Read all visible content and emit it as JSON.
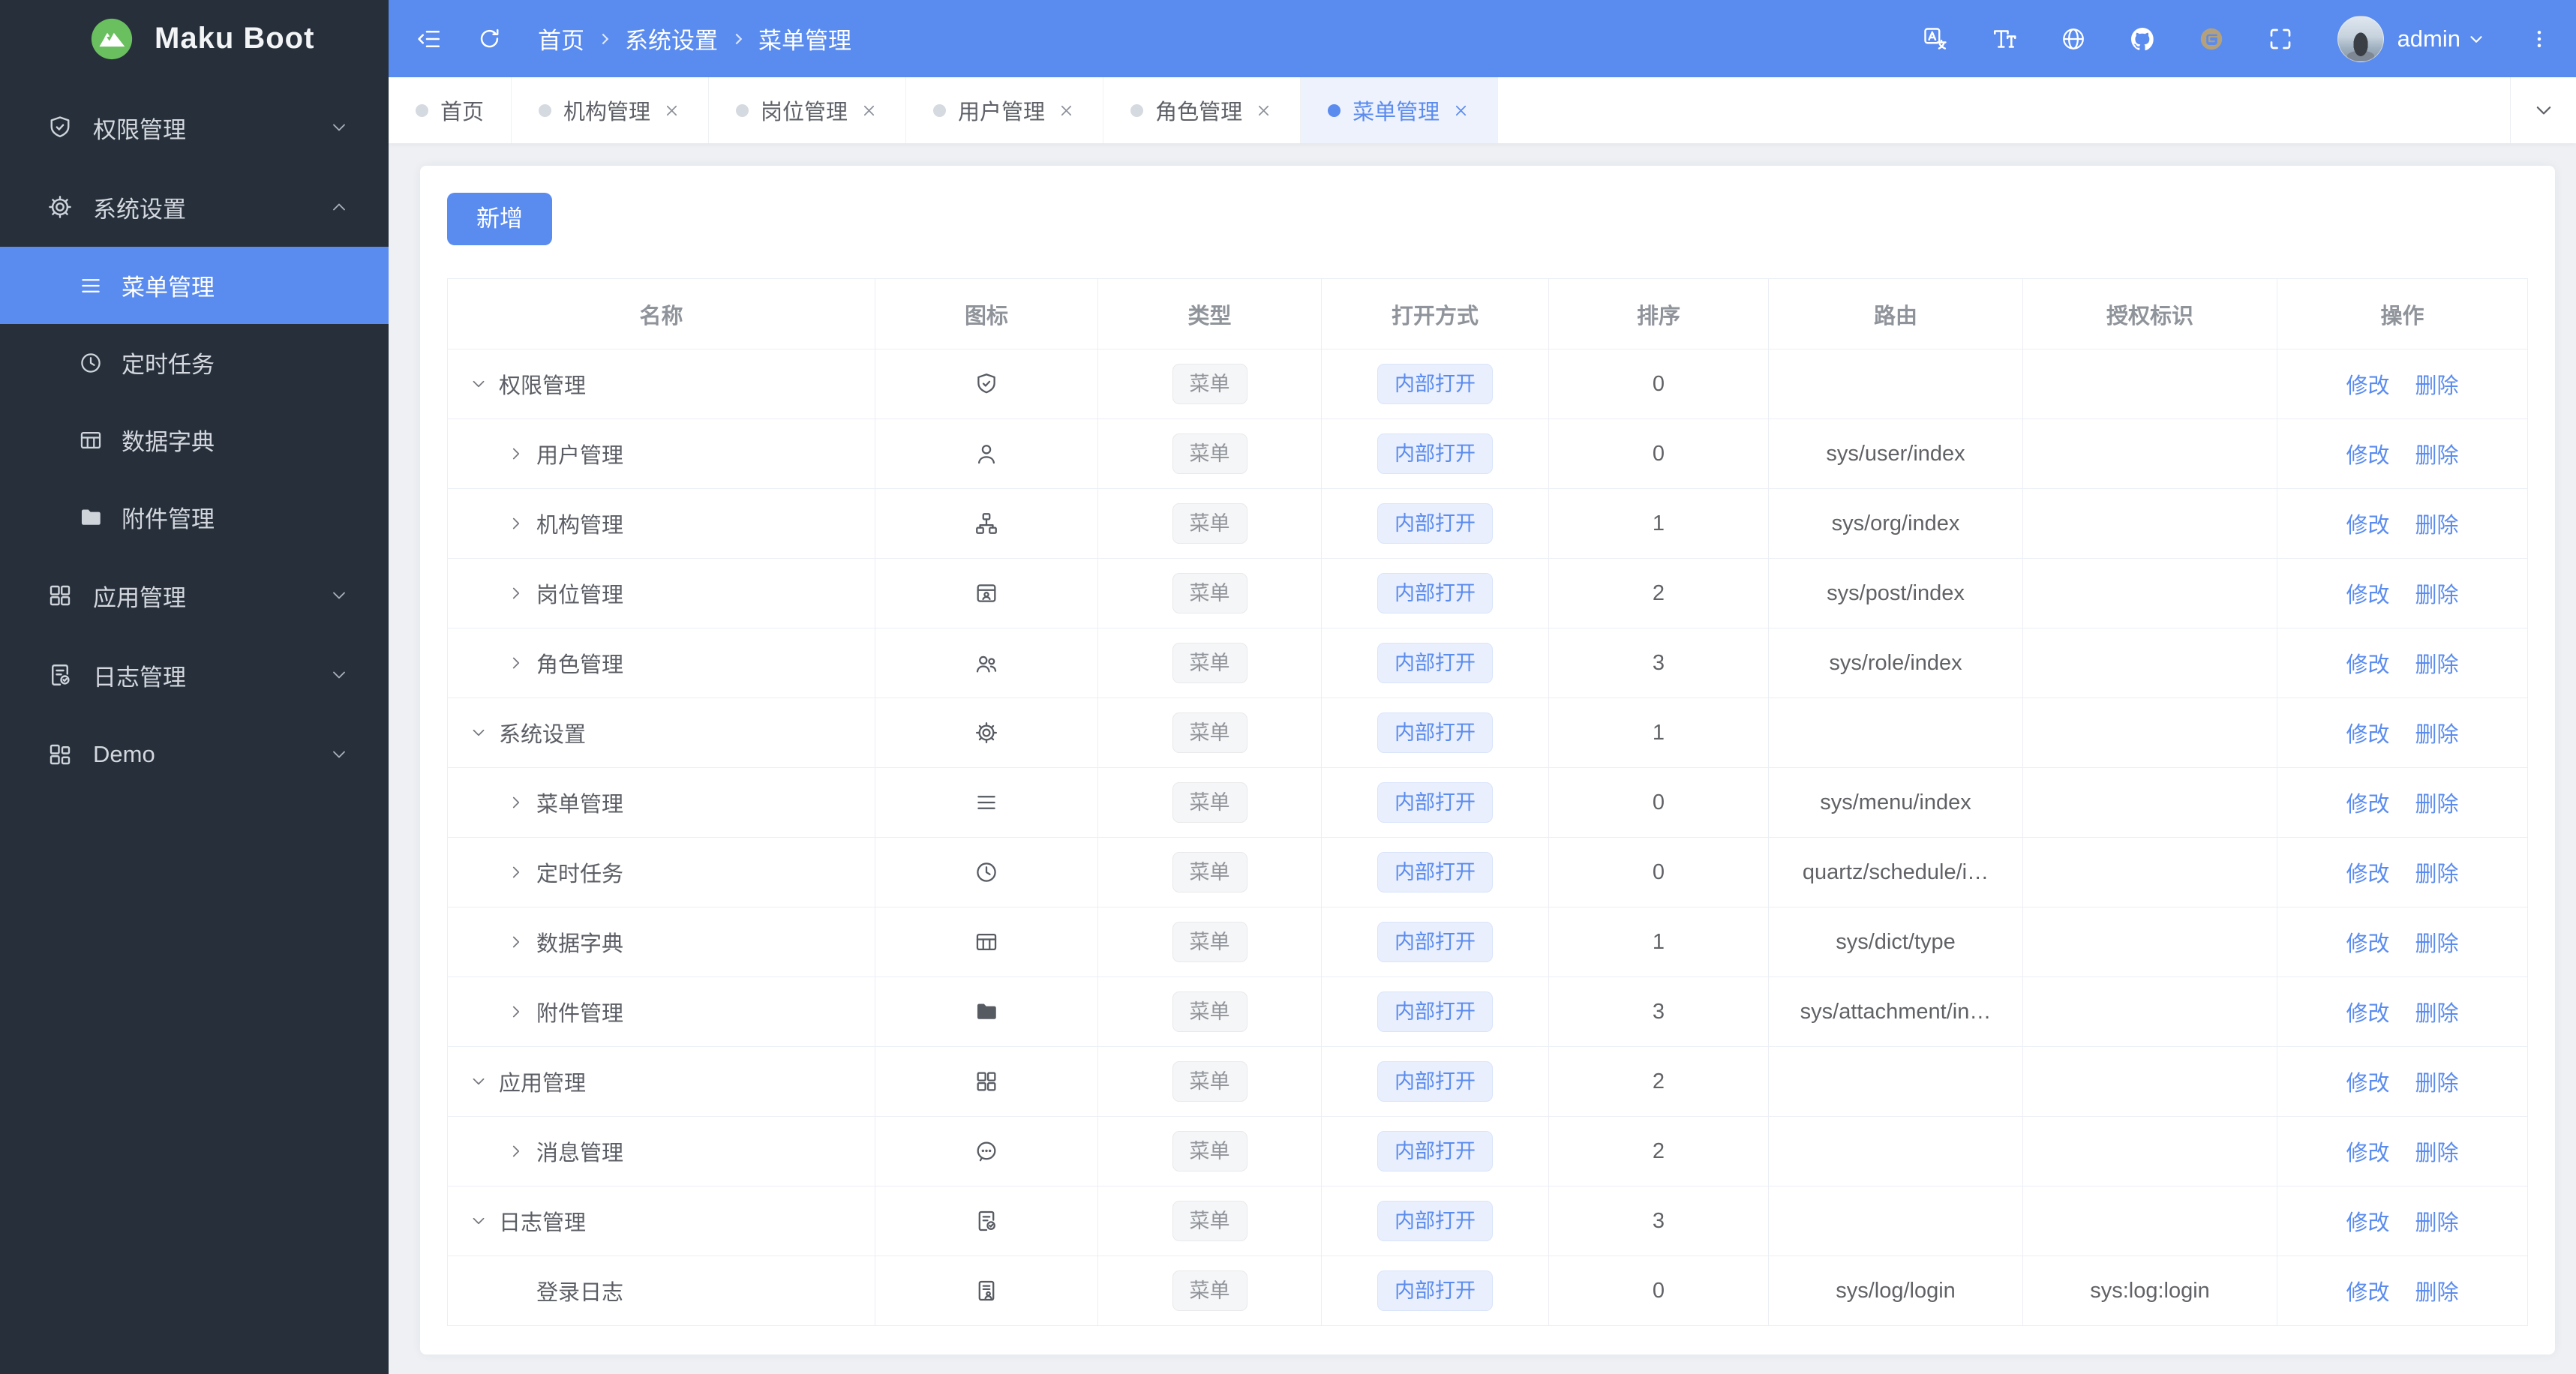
{
  "app": {
    "name": "Maku Boot"
  },
  "colors": {
    "accent": "#5a8bee",
    "sidebar_bg": "#262f3a",
    "header_bg": "#5a8bee",
    "content_bg": "#eef0f4",
    "tag_blue_bg": "#e9effd",
    "tag_gray_text": "#909399",
    "logo_green": "#6abf5e"
  },
  "header": {
    "breadcrumb": [
      "首页",
      "系统设置",
      "菜单管理"
    ],
    "user": "admin",
    "right_icons": [
      "translate-icon",
      "font-size-icon",
      "globe-icon",
      "github-icon",
      "gitee-icon",
      "fullscreen-icon"
    ]
  },
  "tabs": [
    {
      "label": "首页",
      "closable": false,
      "active": false
    },
    {
      "label": "机构管理",
      "closable": true,
      "active": false
    },
    {
      "label": "岗位管理",
      "closable": true,
      "active": false
    },
    {
      "label": "用户管理",
      "closable": true,
      "active": false
    },
    {
      "label": "角色管理",
      "closable": true,
      "active": false
    },
    {
      "label": "菜单管理",
      "closable": true,
      "active": true
    }
  ],
  "sidebar": {
    "items": [
      {
        "label": "权限管理",
        "icon": "shield-icon",
        "chevron": "chevron-down-icon"
      },
      {
        "label": "系统设置",
        "icon": "gear-icon",
        "chevron": "chevron-up-icon",
        "expanded": true,
        "children": [
          {
            "label": "菜单管理",
            "icon": "menu-icon",
            "active": true
          },
          {
            "label": "定时任务",
            "icon": "clock-icon",
            "active": false
          },
          {
            "label": "数据字典",
            "icon": "dict-icon",
            "active": false
          },
          {
            "label": "附件管理",
            "icon": "folder-icon",
            "active": false
          }
        ]
      },
      {
        "label": "应用管理",
        "icon": "apps-icon",
        "chevron": "chevron-down-icon"
      },
      {
        "label": "日志管理",
        "icon": "log-icon",
        "chevron": "chevron-down-icon"
      },
      {
        "label": "Demo",
        "icon": "demo-icon",
        "chevron": "chevron-down-icon"
      }
    ]
  },
  "toolbar": {
    "add_label": "新增"
  },
  "table": {
    "columns": [
      "名称",
      "图标",
      "类型",
      "打开方式",
      "排序",
      "路由",
      "授权标识",
      "操作"
    ],
    "ops": [
      "修改",
      "删除"
    ],
    "rows": [
      {
        "level": 1,
        "arrow": "expanded",
        "name": "权限管理",
        "icon": "shield-icon",
        "type": "菜单",
        "open": "内部打开",
        "sort": "0",
        "route": "",
        "auth": ""
      },
      {
        "level": 2,
        "arrow": "collapsed",
        "name": "用户管理",
        "icon": "user-icon",
        "type": "菜单",
        "open": "内部打开",
        "sort": "0",
        "route": "sys/user/index",
        "auth": ""
      },
      {
        "level": 2,
        "arrow": "collapsed",
        "name": "机构管理",
        "icon": "org-icon",
        "type": "菜单",
        "open": "内部打开",
        "sort": "1",
        "route": "sys/org/index",
        "auth": ""
      },
      {
        "level": 2,
        "arrow": "collapsed",
        "name": "岗位管理",
        "icon": "post-icon",
        "type": "菜单",
        "open": "内部打开",
        "sort": "2",
        "route": "sys/post/index",
        "auth": ""
      },
      {
        "level": 2,
        "arrow": "collapsed",
        "name": "角色管理",
        "icon": "role-icon",
        "type": "菜单",
        "open": "内部打开",
        "sort": "3",
        "route": "sys/role/index",
        "auth": ""
      },
      {
        "level": 1,
        "arrow": "expanded",
        "name": "系统设置",
        "icon": "gear-icon",
        "type": "菜单",
        "open": "内部打开",
        "sort": "1",
        "route": "",
        "auth": ""
      },
      {
        "level": 2,
        "arrow": "collapsed",
        "name": "菜单管理",
        "icon": "menu-icon",
        "type": "菜单",
        "open": "内部打开",
        "sort": "0",
        "route": "sys/menu/index",
        "auth": ""
      },
      {
        "level": 2,
        "arrow": "collapsed",
        "name": "定时任务",
        "icon": "clock-icon",
        "type": "菜单",
        "open": "内部打开",
        "sort": "0",
        "route": "quartz/schedule/i…",
        "auth": ""
      },
      {
        "level": 2,
        "arrow": "collapsed",
        "name": "数据字典",
        "icon": "dict-icon",
        "type": "菜单",
        "open": "内部打开",
        "sort": "1",
        "route": "sys/dict/type",
        "auth": ""
      },
      {
        "level": 2,
        "arrow": "collapsed",
        "name": "附件管理",
        "icon": "folder-icon",
        "type": "菜单",
        "open": "内部打开",
        "sort": "3",
        "route": "sys/attachment/in…",
        "auth": ""
      },
      {
        "level": 1,
        "arrow": "expanded",
        "name": "应用管理",
        "icon": "apps-icon",
        "type": "菜单",
        "open": "内部打开",
        "sort": "2",
        "route": "",
        "auth": ""
      },
      {
        "level": 2,
        "arrow": "collapsed",
        "name": "消息管理",
        "icon": "message-icon",
        "type": "菜单",
        "open": "内部打开",
        "sort": "2",
        "route": "",
        "auth": ""
      },
      {
        "level": 1,
        "arrow": "expanded",
        "name": "日志管理",
        "icon": "log-icon",
        "type": "菜单",
        "open": "内部打开",
        "sort": "3",
        "route": "",
        "auth": ""
      },
      {
        "level": 2,
        "arrow": "none",
        "name": "登录日志",
        "icon": "login-log-icon",
        "type": "菜单",
        "open": "内部打开",
        "sort": "0",
        "route": "sys/log/login",
        "auth": "sys:log:login"
      }
    ]
  }
}
